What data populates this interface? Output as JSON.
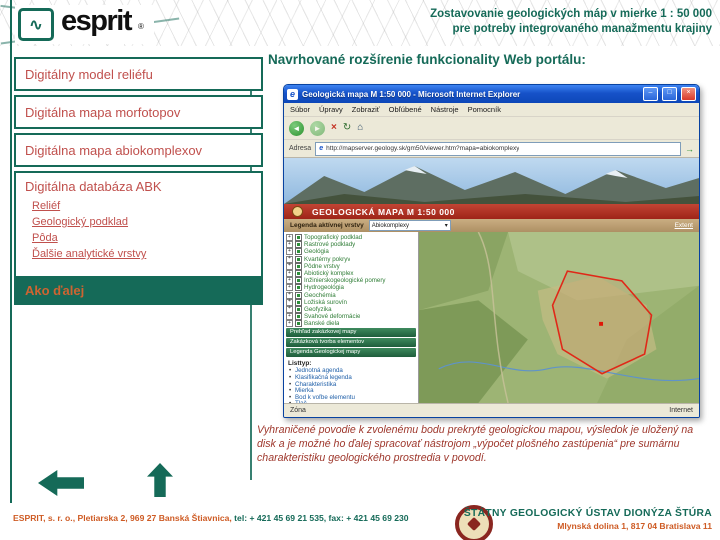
{
  "header": {
    "logo_text": "esprit",
    "logo_reg": "®",
    "title_line1": "Zostavovanie geologických máp v mierke 1 : 50 000",
    "title_line2": "pre potreby integrovaného manažmentu krajiny"
  },
  "sidebar": {
    "items": [
      "Digitálny model reliéfu",
      "Digitálna mapa morfotopov",
      "Digitálna mapa abiokomplexov"
    ],
    "database_title": "Digitálna databáza ABK",
    "database_links": [
      "Reliéf",
      "Geologický podklad",
      "Pôda",
      "Ďalšie analytické vrstvy"
    ],
    "action_label": "Ako ďalej"
  },
  "main": {
    "heading": "Navrhované rozšírenie funkcionality Web portálu:",
    "caption": "Vyhraničené povodie k zvolenému bodu prekryté geologickou mapou, výsledok je uložený na disk a je možné ho ďalej spracovať nástrojom „výpočet plošného zastúpenia“ pre sumárnu charakteristiku geologického prostredia v povodí."
  },
  "browser": {
    "window_title": "Geologická mapa M 1:50 000 - Microsoft Internet Explorer",
    "menu_items": [
      "Súbor",
      "Úpravy",
      "Zobraziť",
      "Obľúbené",
      "Nástroje",
      "Pomocník"
    ],
    "address_label": "Adresa",
    "address_url": "http://mapserver.geology.sk/gm50/viewer.htm?mapa=abiokomplexy",
    "map_title": "GEOLOGICKÁ MAPA    M 1:50 000",
    "legend_label": "Legenda aktívnej vrstvy",
    "legend_value": "Abiokomplexy",
    "extent_link": "Extent",
    "layers": [
      "Topografický podklad",
      "Rastrové podklady",
      "Geológia",
      "Kvartérny pokryv",
      "Pôdne vrstvy",
      "Abiotický komplex",
      "Inžinierskogeologické pomery",
      "Hydrogeológia",
      "Geochémia",
      "Ložiská surovín",
      "Geofyzika",
      "Svahové deformácie",
      "Banské diela"
    ],
    "panel_tabs": [
      "Prehľad zakázkovej mapy",
      "Zakázková tvorba elementov",
      "Legenda Geologickej mapy"
    ],
    "listtype_title": "Listtyp:",
    "listtype_items": [
      "Jednotná agenda",
      "Klasifikačná legenda",
      "Charakteristika",
      "Mierka",
      "Bod k voľbe elementu",
      "Tlač"
    ],
    "status_left": "Zóna",
    "status_right": "Internet"
  },
  "footer": {
    "esprit_address": "ESPRIT, s. r. o., Pletiarska 2, 969 27 Banská Štiavnica, ",
    "esprit_phone": "tel: + 421 45 69 21 535, fax: + 421 45 69 230",
    "institute_name": "ŠTÁTNY GEOLOGICKÝ ÚSTAV DIONÝZA ŠTÚRA",
    "institute_address": "Mlynská dolina 1, 817 04 Bratislava 11"
  },
  "icons": {
    "wave": "∿",
    "minimize": "–",
    "maximize": "□",
    "close": "×",
    "back": "◄",
    "forward": "►",
    "stop": "×",
    "refresh": "↻",
    "home": "⌂",
    "go": "→",
    "dropdown": "▾",
    "page": "e"
  }
}
